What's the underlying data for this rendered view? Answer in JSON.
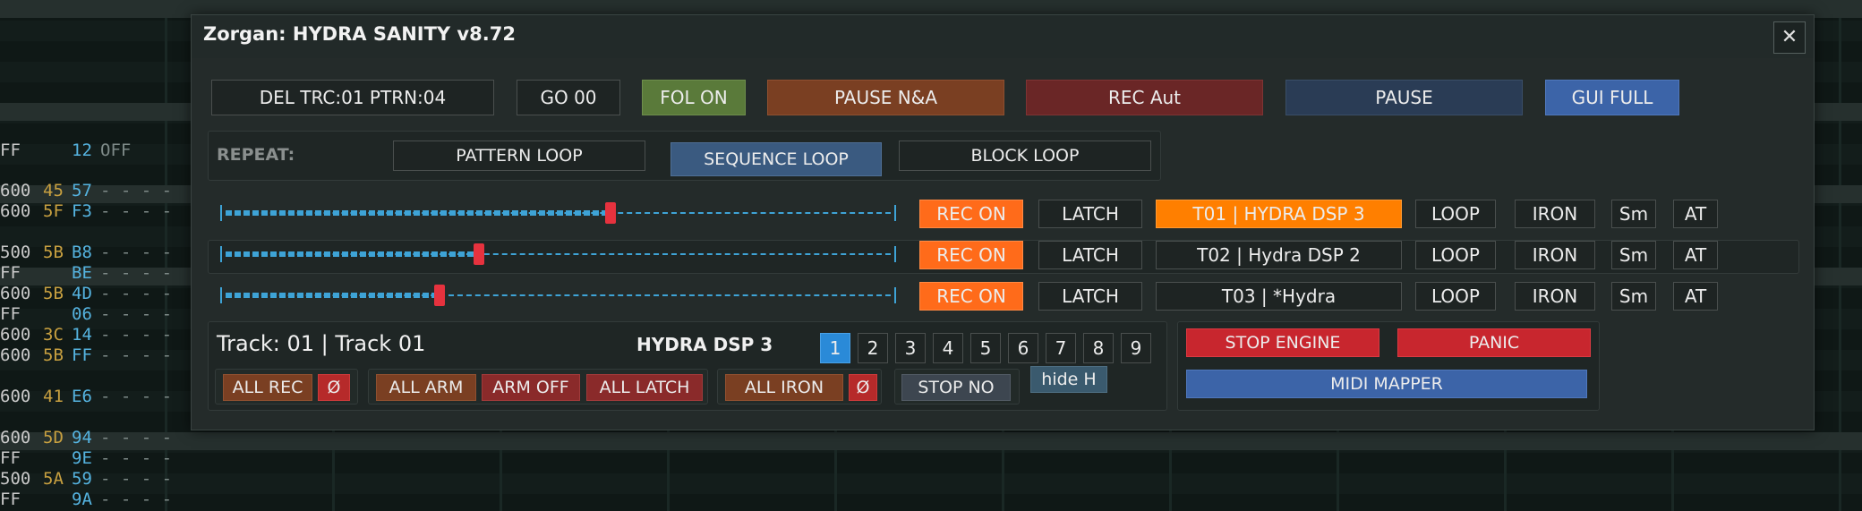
{
  "window": {
    "title": "Zorgan: HYDRA SANITY v8.72",
    "close_label": "✕"
  },
  "colors": {
    "orange": "#ff6b1a",
    "red": "#c8262e",
    "dark_red": "#7a2a2a",
    "brown": "#7a3f22",
    "green": "#5a7a3a",
    "blue": "#3c64a8",
    "navy": "#2a3c55",
    "steel": "#3a5a80",
    "accent": "#3ea3d6",
    "knob": "#e6323e"
  },
  "toolbar": {
    "del_trc": "DEL TRC:01 PTRN:04",
    "go": "GO 00",
    "fol_on": "FOL ON",
    "pause_na": "PAUSE N&A",
    "rec_aut": "REC Aut",
    "pause": "PAUSE",
    "gui_full": "GUI FULL"
  },
  "repeat": {
    "label": "REPEAT:",
    "pattern_loop": "PATTERN LOOP",
    "sequence_loop": "SEQUENCE LOOP",
    "block_loop": "BLOCK LOOP",
    "active": "sequence_loop"
  },
  "tracks": [
    {
      "rec": "REC ON",
      "latch": "LATCH",
      "name": "T01 | HYDRA DSP 3",
      "loop": "LOOP",
      "iron": "IRON",
      "sm": "Sm",
      "at": "AT",
      "level": 0.58,
      "selected": true
    },
    {
      "rec": "REC ON",
      "latch": "LATCH",
      "name": "T02 | Hydra DSP 2",
      "loop": "LOOP",
      "iron": "IRON",
      "sm": "Sm",
      "at": "AT",
      "level": 0.38,
      "selected": false
    },
    {
      "rec": "REC ON",
      "latch": "LATCH",
      "name": "T03 | *Hydra",
      "loop": "LOOP",
      "iron": "IRON",
      "sm": "Sm",
      "at": "AT",
      "level": 0.32,
      "selected": false
    }
  ],
  "bottom": {
    "track_label": "Track: 01 | Track 01",
    "device_label": "HYDRA DSP 3",
    "numbers": [
      "1",
      "2",
      "3",
      "4",
      "5",
      "6",
      "7",
      "8",
      "9"
    ],
    "selected_number": "1",
    "all_rec": "ALL REC",
    "null1": "Ø",
    "all_arm": "ALL ARM",
    "arm_off": "ARM OFF",
    "all_latch": "ALL LATCH",
    "all_iron": "ALL IRON",
    "null2": "Ø",
    "stop_no": "STOP NO",
    "hide_h": "hide H",
    "stop_engine": "STOP ENGINE",
    "panic": "PANIC",
    "midi_mapper": "MIDI MAPPER"
  },
  "background_tracker": {
    "rows": [
      {
        "a": "FF",
        "b": "",
        "c": "12",
        "d": "OFF"
      },
      {
        "a": "600",
        "b": "45",
        "c": "57",
        "d": "- - - -"
      },
      {
        "a": "600",
        "b": "5F",
        "c": "F3",
        "d": "- - - -"
      },
      {
        "a": "500",
        "b": "5B",
        "c": "B8",
        "d": "- - - -"
      },
      {
        "a": "FF",
        "b": "",
        "c": "BE",
        "d": "- - - -"
      },
      {
        "a": "600",
        "b": "5B",
        "c": "4D",
        "d": "- - - -"
      },
      {
        "a": "FF",
        "b": "",
        "c": "06",
        "d": "- - - -"
      },
      {
        "a": "600",
        "b": "3C",
        "c": "14",
        "d": "- - - -"
      },
      {
        "a": "600",
        "b": "5B",
        "c": "FF",
        "d": "- - - -"
      },
      {
        "a": "600",
        "b": "41",
        "c": "E6",
        "d": "- - - -"
      },
      {
        "a": "600",
        "b": "5D",
        "c": "94",
        "d": "- - - -"
      },
      {
        "a": "FF",
        "b": "",
        "c": "9E",
        "d": "- - - -"
      },
      {
        "a": "500",
        "b": "5A",
        "c": "59",
        "d": "- - - -"
      },
      {
        "a": "FF",
        "b": "",
        "c": "9A",
        "d": "- - - -"
      }
    ]
  }
}
